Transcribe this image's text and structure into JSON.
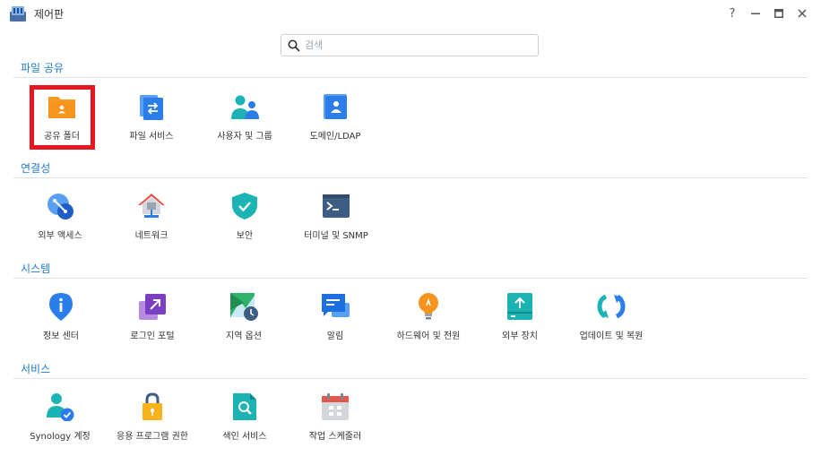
{
  "window": {
    "title": "제어판",
    "help_label": "?"
  },
  "search": {
    "placeholder": "검색"
  },
  "sections": [
    {
      "title": "파일 공유",
      "items": [
        {
          "label": "공유 폴더",
          "icon": "shared-folder-icon"
        },
        {
          "label": "파일 서비스",
          "icon": "file-services-icon"
        },
        {
          "label": "사용자 및 그룹",
          "icon": "users-groups-icon"
        },
        {
          "label": "도메인/LDAP",
          "icon": "domain-ldap-icon"
        }
      ]
    },
    {
      "title": "연결성",
      "items": [
        {
          "label": "외부 액세스",
          "icon": "external-access-icon"
        },
        {
          "label": "네트워크",
          "icon": "network-icon"
        },
        {
          "label": "보안",
          "icon": "security-shield-icon"
        },
        {
          "label": "터미널 및 SNMP",
          "icon": "terminal-icon"
        }
      ]
    },
    {
      "title": "시스템",
      "items": [
        {
          "label": "정보 센터",
          "icon": "info-center-icon"
        },
        {
          "label": "로그인 포털",
          "icon": "login-portal-icon"
        },
        {
          "label": "지역 옵션",
          "icon": "regional-options-icon"
        },
        {
          "label": "알림",
          "icon": "notification-icon"
        },
        {
          "label": "하드웨어 및 전원",
          "icon": "hardware-power-icon"
        },
        {
          "label": "외부 장치",
          "icon": "external-devices-icon"
        },
        {
          "label": "업데이트 및 복원",
          "icon": "update-restore-icon"
        }
      ]
    },
    {
      "title": "서비스",
      "items": [
        {
          "label": "Synology 계정",
          "icon": "synology-account-icon"
        },
        {
          "label": "응용 프로그램 권한",
          "icon": "application-privileges-icon"
        },
        {
          "label": "색인 서비스",
          "icon": "indexing-service-icon"
        },
        {
          "label": "작업 스케줄러",
          "icon": "task-scheduler-icon"
        }
      ]
    }
  ],
  "colors": {
    "section_title": "#1f7acc",
    "highlight_border": "#e5181f",
    "orange_folder": "#f7941d",
    "blue": "#2b7de9",
    "teal": "#1bb3b3"
  }
}
